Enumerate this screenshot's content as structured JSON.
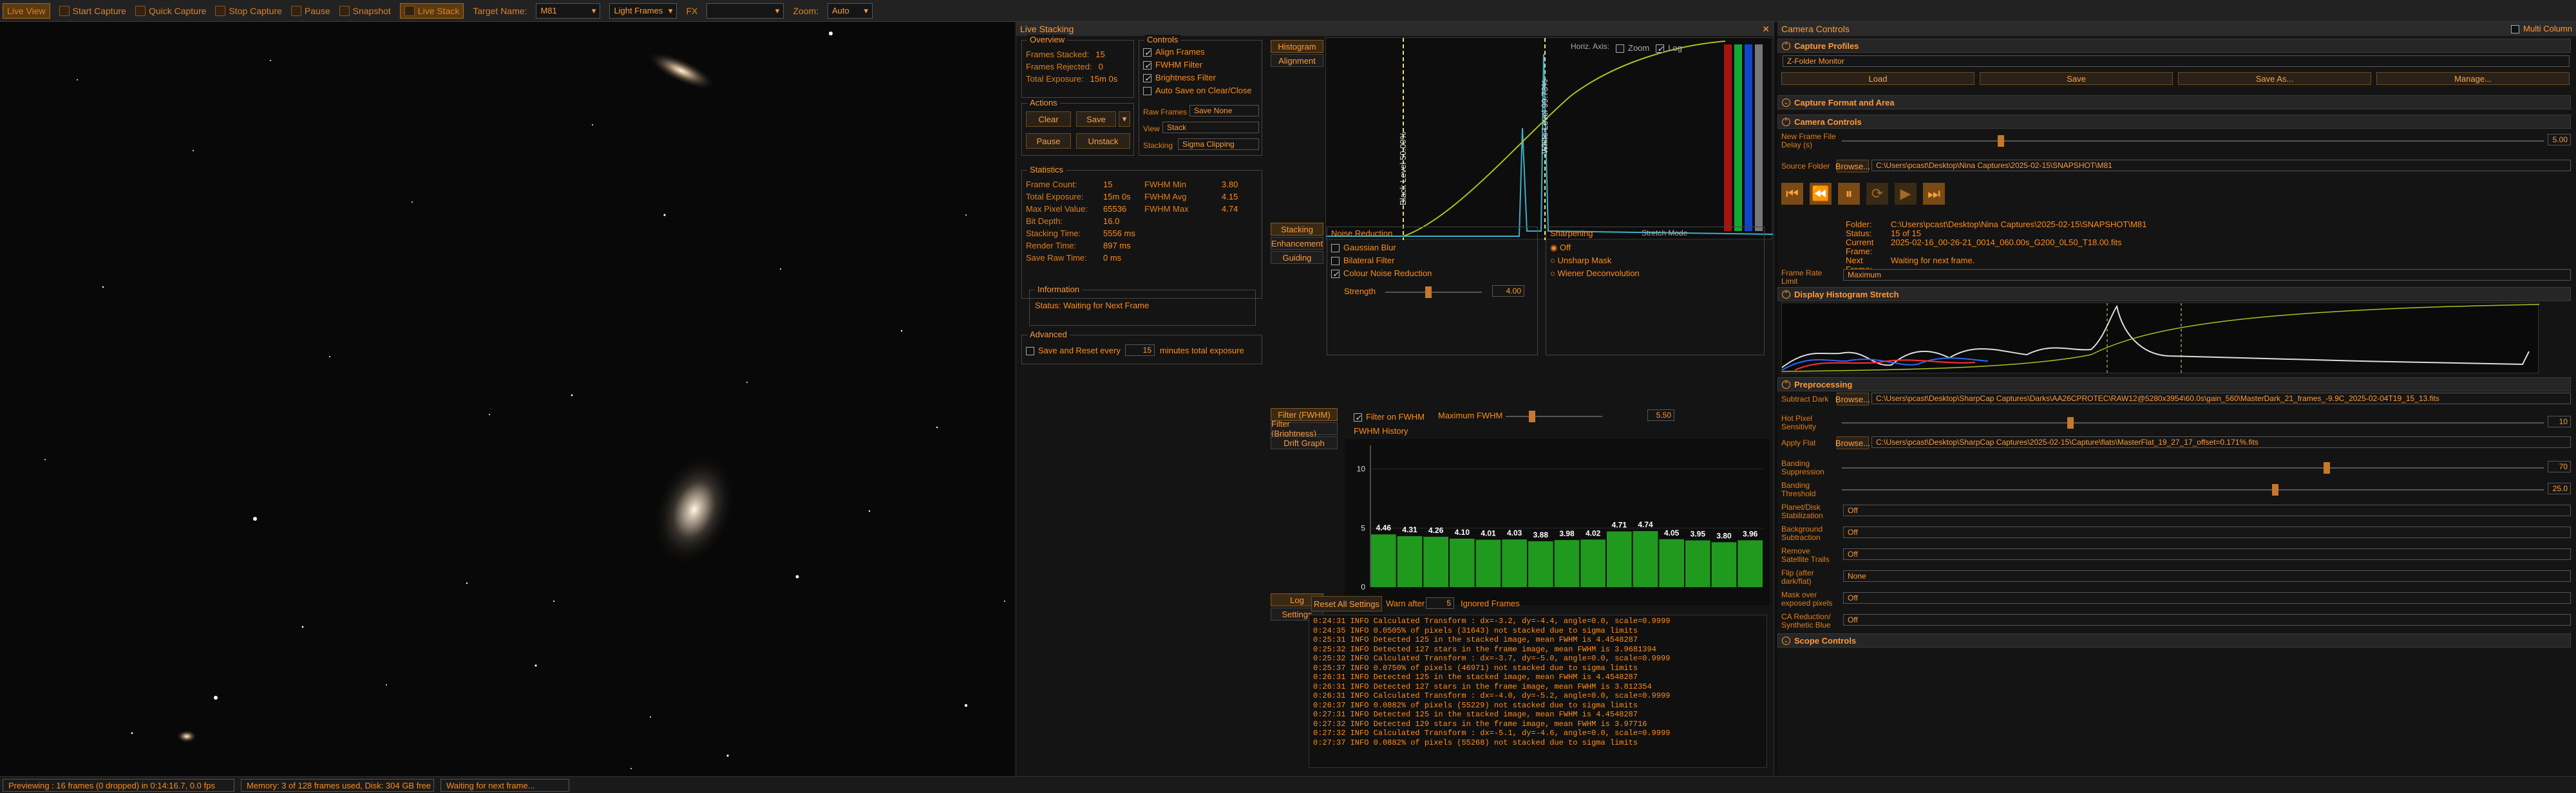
{
  "toolbar": {
    "live_view": "Live View",
    "start_capture": "Start Capture",
    "quick_capture": "Quick Capture",
    "stop_capture": "Stop Capture",
    "pause": "Pause",
    "snapshot": "Snapshot",
    "live_stack": "Live Stack",
    "target_name_label": "Target Name:",
    "target_name": "M81",
    "frame_type": "Light Frames",
    "fx_label": "FX",
    "zoom_label": "Zoom:",
    "zoom_value": "Auto"
  },
  "status": {
    "preview": "Previewing : 16 frames (0 dropped) in 0:14:16.7, 0.0 fps",
    "memory": "Memory: 3 of 128 frames used, Disk: 304 GB free",
    "waiting": "Waiting for next frame..."
  },
  "live_stacking": {
    "title": "Live Stacking",
    "overview": {
      "title": "Overview",
      "frames_stacked_label": "Frames Stacked:",
      "frames_stacked": "15",
      "frames_rejected_label": "Frames Rejected:",
      "frames_rejected": "0",
      "total_exposure_label": "Total Exposure:",
      "total_exposure": "15m 0s"
    },
    "actions": {
      "title": "Actions",
      "clear": "Clear",
      "save": "Save",
      "pause": "Pause",
      "unstack": "Unstack"
    },
    "controls": {
      "title": "Controls",
      "align_frames": "Align Frames",
      "fwhm_filter": "FWHM Filter",
      "brightness_filter": "Brightness Filter",
      "auto_save": "Auto Save on Clear/Close",
      "raw_frames_label": "Raw Frames",
      "raw_frames": "Save None",
      "view_label": "View",
      "view": "Stack",
      "stacking_label": "Stacking",
      "stacking": "Sigma Clipping"
    },
    "statistics": {
      "title": "Statistics",
      "frame_count_label": "Frame Count:",
      "frame_count": "15",
      "total_exposure_label": "Total Exposure:",
      "total_exposure": "15m 0s",
      "max_pixel_label": "Max Pixel Value:",
      "max_pixel": "65536",
      "bit_depth_label": "Bit Depth:",
      "bit_depth": "16.0",
      "stacking_time_label": "Stacking Time:",
      "stacking_time": "5556 ms",
      "render_time_label": "Render Time:",
      "render_time": "897 ms",
      "save_raw_label": "Save Raw Time:",
      "save_raw": "0 ms",
      "fwhm_min_label": "FWHM Min",
      "fwhm_min": "3.80",
      "fwhm_avg_label": "FWHM Avg",
      "fwhm_avg": "4.15",
      "fwhm_max_label": "FWHM Max",
      "fwhm_max": "4.74"
    },
    "information": {
      "title": "Information",
      "status": "Status: Waiting for Next Frame"
    },
    "advanced": {
      "title": "Advanced",
      "save_reset_prefix": "Save and Reset every",
      "save_reset_value": "15",
      "save_reset_suffix": "minutes total exposure"
    },
    "histogram_tabs": [
      "Histogram",
      "Alignment"
    ],
    "histogram": {
      "horiz_axis": "Horiz. Axis:",
      "zoom": "Zoom",
      "log": "Log",
      "stretch_mode": "Stretch Mode",
      "black_level": "Black Level 50.00%",
      "white_level": "White Level 99.73%"
    },
    "mid_tabs": [
      "Stacking",
      "Enhancement",
      "Guiding"
    ],
    "noise": {
      "title": "Noise Reduction",
      "gaussian": "Gaussian Blur",
      "bilateral": "Bilateral Filter",
      "colour": "Colour Noise Reduction",
      "strength_label": "Strength",
      "strength_value": "4.00"
    },
    "sharpening": {
      "title": "Sharpening",
      "off": "Off",
      "unsharp": "Unsharp Mask",
      "wiener": "Wiener Deconvolution"
    },
    "filter_tabs": [
      "Filter (FWHM)",
      "Filter (Brightness)",
      "Drift Graph"
    ],
    "fwhm_filter": {
      "filter_on_label": "Filter on FWHM",
      "max_label": "Maximum FWHM",
      "max_value": "5.50",
      "history_title": "FWHM History"
    },
    "log_tabs": [
      "Log",
      "Settings"
    ],
    "log_controls": {
      "reset": "Reset All Settings",
      "warn_after": "Warn after",
      "warn_value": "5",
      "ignored": "Ignored Frames"
    },
    "log_lines": [
      "0:24:31 INFO  Calculated Transform : dx=-3.2, dy=-4.4, angle=0.0, scale=0.9999",
      "0:24:35 INFO  0.0505% of pixels (31643) not stacked due to sigma limits",
      "0:25:31 INFO  Detected 125 in the stacked image, mean FWHM is 4.4548287",
      "0:25:32 INFO  Detected 127 stars in the frame image, mean FWHM is 3.9681394",
      "0:25:32 INFO  Calculated Transform : dx=-3.7, dy=-5.0, angle=0.0, scale=0.9999",
      "0:25:37 INFO  0.0750% of pixels (46971) not stacked due to sigma limits",
      "0:26:31 INFO  Detected 125 in the stacked image, mean FWHM is 4.4548287",
      "0:26:31 INFO  Detected 127 stars in the frame image, mean FWHM is 3.812354",
      "0:26:31 INFO  Calculated Transform : dx=-4.0, dy=-5.2, angle=0.0, scale=0.9999",
      "0:26:37 INFO  0.0882% of pixels (55229) not stacked due to sigma limits",
      "0:27:31 INFO  Detected 125 in the stacked image, mean FWHM is 4.4548287",
      "0:27:32 INFO  Detected 129 stars in the frame image, mean FWHM is 3.97716",
      "0:27:32 INFO  Calculated Transform : dx=-5.1, dy=-4.6, angle=0.0, scale=0.9999",
      "0:27:37 INFO  0.0882% of pixels (55268) not stacked due to sigma limits"
    ]
  },
  "chart_data": {
    "type": "bar",
    "title": "FWHM History",
    "values": [
      4.46,
      4.31,
      4.26,
      4.1,
      4.01,
      4.03,
      3.88,
      3.98,
      4.02,
      4.71,
      4.74,
      4.05,
      3.95,
      3.8,
      3.96
    ],
    "labels": [
      "4.46",
      "4.31",
      "4.26",
      "4.10",
      "4.01",
      "4.03",
      "3.88",
      "3.98",
      "4.02",
      "4.71",
      "4.74",
      "4.05",
      "3.95",
      "3.80",
      "3.96"
    ],
    "yticks": [
      "10",
      "5",
      "0"
    ],
    "ylim": [
      0,
      12
    ],
    "bar_color": "#1f9a1f"
  },
  "camera_controls": {
    "title": "Camera Controls",
    "multi_column": "Multi Column",
    "capture_profiles": "Capture Profiles",
    "folder_monitor": "Z-Folder Monitor",
    "profile_buttons": [
      "Load",
      "Save",
      "Save As...",
      "Manage..."
    ],
    "capture_format": "Capture Format and Area",
    "camera_controls_hdr": "Camera Controls",
    "new_frame_delay_label": "New Frame File Delay (s)",
    "new_frame_delay": "5.00",
    "source_folder_label": "Source Folder",
    "browse": "Browse...",
    "source_folder": "C:\\Users\\pcast\\Desktop\\Nina Captures\\2025-02-15\\SNAPSHOT\\M81",
    "folder_label": "Folder:",
    "folder": "C:\\Users\\pcast\\Desktop\\Nina Captures\\2025-02-15\\SNAPSHOT\\M81",
    "status_label": "Status:",
    "status": "15 of 15",
    "current_frame_label": "Current Frame:",
    "current_frame": "2025-02-16_00-26-21_0014_060.00s_G200_0L50_T18.00.fits",
    "next_frame_label": "Next Frame:",
    "next_frame": "Waiting for next frame.",
    "frame_rate_label": "Frame Rate Limit",
    "frame_rate": "Maximum",
    "display_stretch": "Display Histogram Stretch",
    "preprocessing": "Preprocessing",
    "subtract_dark_label": "Subtract Dark",
    "subtract_dark": "C:\\Users\\pcast\\Desktop\\SharpCap Captures\\Darks\\AA26CPROTEC\\RAW12@5280x3954\\60.0s\\gain_560\\MasterDark_21_frames_-9.9C_2025-02-04T19_15_13.fits",
    "hot_pixel_label": "Hot Pixel Sensitivity",
    "hot_pixel": "10",
    "apply_flat_label": "Apply Flat",
    "apply_flat": "C:\\Users\\pcast\\Desktop\\SharpCap Captures\\2025-02-15\\Capture\\flats\\MasterFlat_19_27_17_offset=0.171%.fits",
    "banding_supp_label": "Banding Suppression",
    "banding_supp": "70",
    "banding_thr_label": "Banding Threshold",
    "banding_thr": "25.0",
    "planet_label": "Planet/Disk Stabilization",
    "planet": "Off",
    "bg_label": "Background Subtraction",
    "bg": "Off",
    "sat_label": "Remove Satellite Trails",
    "sat": "Off",
    "flip_label": "Flip (after dark/flat)",
    "flip": "None",
    "mask_label": "Mask over exposed pixels",
    "mask": "Off",
    "ca_label": "CA Reduction/ Synthetic Blue",
    "ca": "Off",
    "scope_controls": "Scope Controls"
  },
  "colors": {
    "accent": "#ff8c1a",
    "panel": "#141414",
    "bar": "#1f9a1f"
  }
}
